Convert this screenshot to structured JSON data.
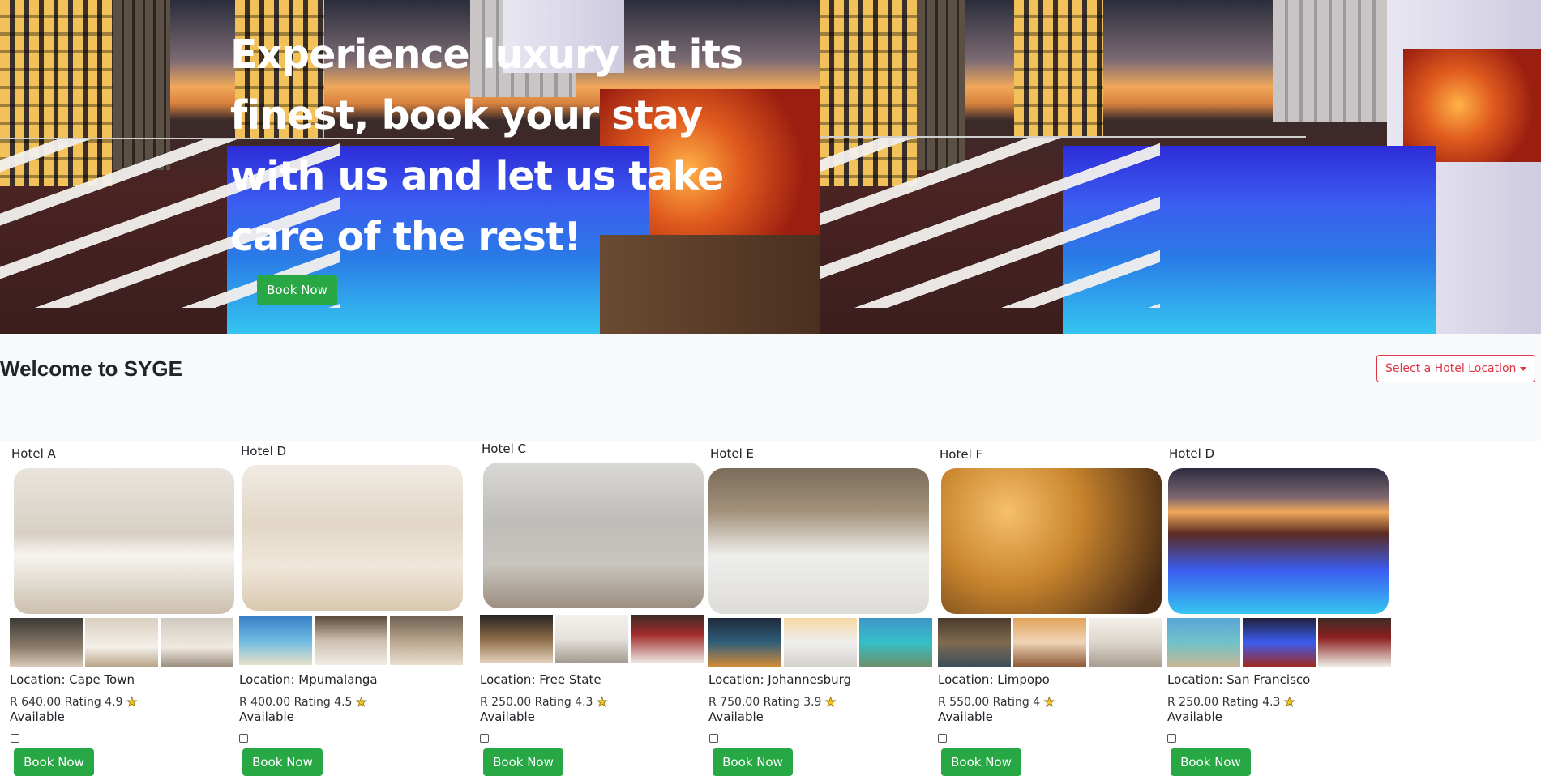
{
  "hero": {
    "title": "Experience luxury at its finest, book your stay with us and let us take care of the rest!",
    "book_button": "Book Now"
  },
  "welcome": {
    "title": "Welcome to SYGE",
    "location_dropdown": "Select a Hotel Location"
  },
  "hotels": [
    {
      "name": "Hotel A",
      "location": "Location: Cape Town",
      "price": "R 640.00 Rating 4.9",
      "availability": "Available",
      "button": "Book Now"
    },
    {
      "name": "Hotel D",
      "location": "Location: Mpumalanga",
      "price": "R 400.00 Rating 4.5",
      "availability": "Available",
      "button": "Book Now"
    },
    {
      "name": "Hotel C",
      "location": "Location: Free State",
      "price": "R 250.00 Rating 4.3",
      "availability": "Available",
      "button": "Book Now"
    },
    {
      "name": "Hotel E",
      "location": "Location: Johannesburg",
      "price": "R 750.00 Rating 3.9",
      "availability": "Available",
      "button": "Book Now"
    },
    {
      "name": "Hotel F",
      "location": "Location: Limpopo",
      "price": "R 550.00 Rating 4",
      "availability": "Available",
      "button": "Book Now"
    },
    {
      "name": "Hotel D",
      "location": "Location: San Francisco",
      "price": "R 250.00 Rating 4.3",
      "availability": "Available",
      "button": "Book Now"
    }
  ],
  "colors": {
    "accent_green": "#28a745",
    "danger_red": "#dc3545",
    "welcome_bg": "#f8f9fa"
  },
  "icons": {
    "rating": "star-icon",
    "dropdown": "caret-down-icon"
  }
}
